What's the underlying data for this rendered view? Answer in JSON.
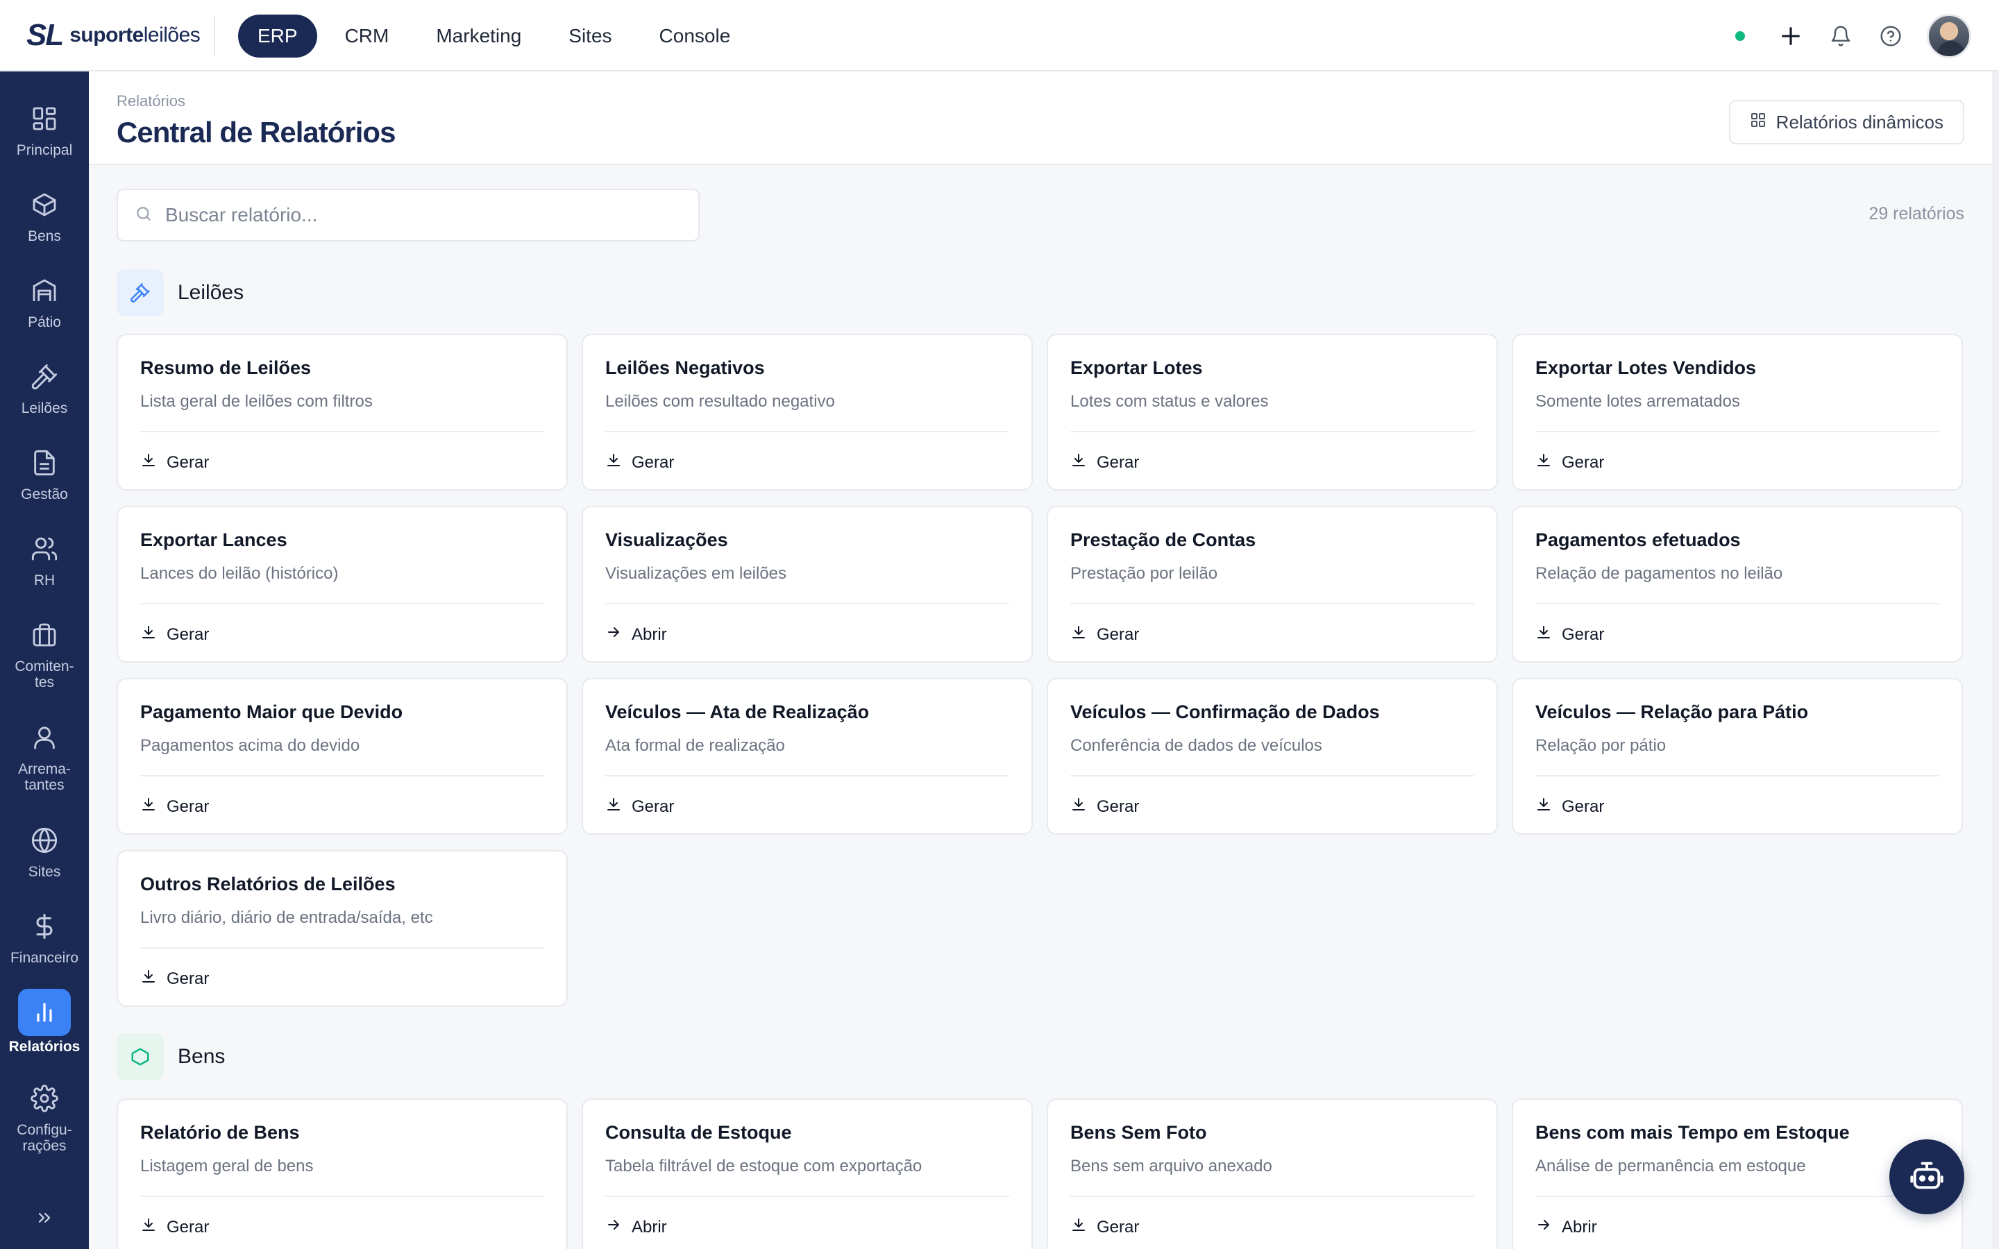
{
  "brand": {
    "mark": "SL",
    "name_bold": "suporte",
    "name_light": "leilões"
  },
  "topnav": [
    {
      "label": "ERP",
      "active": true
    },
    {
      "label": "CRM",
      "active": false
    },
    {
      "label": "Marketing",
      "active": false
    },
    {
      "label": "Sites",
      "active": false
    },
    {
      "label": "Console",
      "active": false
    }
  ],
  "status_color": "#10b981",
  "sidebar": [
    {
      "label": "Principal",
      "icon": "dashboard-icon"
    },
    {
      "label": "Bens",
      "icon": "box-icon"
    },
    {
      "label": "Pátio",
      "icon": "warehouse-icon"
    },
    {
      "label": "Leilões",
      "icon": "gavel-icon"
    },
    {
      "label": "Gestão",
      "icon": "document-icon"
    },
    {
      "label": "RH",
      "icon": "users-icon"
    },
    {
      "label": "Comiten-\ntes",
      "icon": "briefcase-icon"
    },
    {
      "label": "Arrema-\ntantes",
      "icon": "user-icon"
    },
    {
      "label": "Sites",
      "icon": "globe-icon"
    },
    {
      "label": "Financeiro",
      "icon": "dollar-icon"
    },
    {
      "label": "Relatórios",
      "icon": "bar-chart-icon",
      "active": true
    },
    {
      "label": "Configu-\nrações",
      "icon": "gear-icon"
    }
  ],
  "header": {
    "breadcrumb": "Relatórios",
    "title": "Central de Relatórios",
    "dynamic_button": "Relatórios dinâmicos"
  },
  "search": {
    "placeholder": "Buscar relatório..."
  },
  "report_count": "29 relatórios",
  "sections": [
    {
      "title": "Leilões",
      "icon": "gavel-icon",
      "accent": "#3b82f6",
      "cards": [
        {
          "title": "Resumo de Leilões",
          "desc": "Lista geral de leilões com filtros",
          "action": "Gerar"
        },
        {
          "title": "Leilões Negativos",
          "desc": "Leilões com resultado negativo",
          "action": "Gerar"
        },
        {
          "title": "Exportar Lotes",
          "desc": "Lotes com status e valores",
          "action": "Gerar"
        },
        {
          "title": "Exportar Lotes Vendidos",
          "desc": "Somente lotes arrematados",
          "action": "Gerar"
        },
        {
          "title": "Exportar Lances",
          "desc": "Lances do leilão (histórico)",
          "action": "Gerar"
        },
        {
          "title": "Visualizações",
          "desc": "Visualizações em leilões",
          "action": "Abrir"
        },
        {
          "title": "Prestação de Contas",
          "desc": "Prestação por leilão",
          "action": "Gerar"
        },
        {
          "title": "Pagamentos efetuados",
          "desc": "Relação de pagamentos no leilão",
          "action": "Gerar"
        },
        {
          "title": "Pagamento Maior que Devido",
          "desc": "Pagamentos acima do devido",
          "action": "Gerar"
        },
        {
          "title": "Veículos — Ata de Realização",
          "desc": "Ata formal de realização",
          "action": "Gerar"
        },
        {
          "title": "Veículos — Confirmação de Dados",
          "desc": "Conferência de dados de veículos",
          "action": "Gerar"
        },
        {
          "title": "Veículos — Relação para Pátio",
          "desc": "Relação por pátio",
          "action": "Gerar"
        },
        {
          "title": "Outros Relatórios de Leilões",
          "desc": "Livro diário, diário de entrada/saída, etc",
          "action": "Gerar"
        }
      ]
    },
    {
      "title": "Bens",
      "icon": "hexagon-icon",
      "accent": "#10b981",
      "cards": [
        {
          "title": "Relatório de Bens",
          "desc": "Listagem geral de bens",
          "action": "Gerar"
        },
        {
          "title": "Consulta de Estoque",
          "desc": "Tabela filtrável de estoque com exportação",
          "action": "Abrir"
        },
        {
          "title": "Bens Sem Foto",
          "desc": "Bens sem arquivo anexado",
          "action": "Gerar"
        },
        {
          "title": "Bens com mais Tempo em Estoque",
          "desc": "Análise de permanência em estoque",
          "action": "Abrir"
        }
      ]
    }
  ]
}
